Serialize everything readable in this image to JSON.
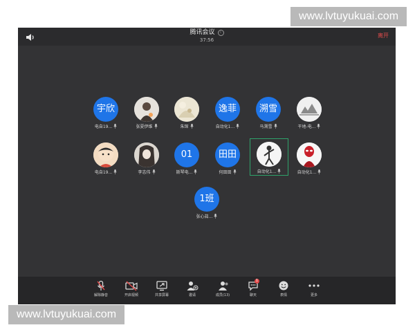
{
  "watermark": {
    "top": "www.lvtuyukuai.com",
    "bottom": "www.lvtuyukuai.com"
  },
  "header": {
    "title": "腾讯会议",
    "timer": "37:56",
    "leave_label": "离开"
  },
  "participants": [
    {
      "initials": "宇欣",
      "label": "电自19...",
      "kind": "text"
    },
    {
      "initials": "",
      "label": "张夏伊维",
      "kind": "photo-girl"
    },
    {
      "initials": "",
      "label": "朱琛",
      "kind": "photo-light"
    },
    {
      "initials": "逸菲",
      "label": "自动化1...",
      "kind": "text"
    },
    {
      "initials": "溯雪",
      "label": "马溯雪",
      "kind": "text"
    },
    {
      "initials": "",
      "label": "干地-电...",
      "kind": "photo-sketch"
    },
    {
      "initials": "",
      "label": "电自19...",
      "kind": "photo-cartoon"
    },
    {
      "initials": "",
      "label": "李志伟",
      "kind": "photo-girl2"
    },
    {
      "initials": "01",
      "label": "斯琴电...",
      "kind": "text"
    },
    {
      "initials": "田田",
      "label": "何田田",
      "kind": "text"
    },
    {
      "initials": "",
      "label": "自动化1...",
      "kind": "photo-figure"
    },
    {
      "initials": "",
      "label": "自动化1...",
      "kind": "photo-red"
    },
    {
      "initials": "1班",
      "label": "张心茹...",
      "kind": "text"
    }
  ],
  "toolbar": {
    "mute_label": "解除静音",
    "video_label": "开启视频",
    "share_label": "共享屏幕",
    "invite_label": "邀请",
    "members_label": "成员(13)",
    "chat_label": "聊天",
    "chat_badge": "1",
    "emoji_label": "表情",
    "more_label": "更多"
  },
  "colors": {
    "accent": "#1f75e8",
    "leave": "#e24b4b",
    "active_border": "#2fa36b",
    "background": "#333335"
  }
}
